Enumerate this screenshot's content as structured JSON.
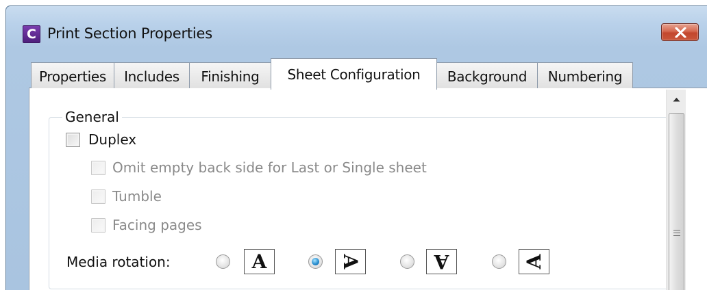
{
  "window": {
    "title": "Print Section Properties",
    "app_icon_letter": "C"
  },
  "tabs": [
    {
      "label": "Properties",
      "active": false
    },
    {
      "label": "Includes",
      "active": false
    },
    {
      "label": "Finishing",
      "active": false
    },
    {
      "label": "Sheet Configuration",
      "active": true
    },
    {
      "label": "Background",
      "active": false
    },
    {
      "label": "Numbering",
      "active": false
    }
  ],
  "general": {
    "group_label": "General",
    "duplex": {
      "label": "Duplex",
      "checked": false,
      "enabled": true
    },
    "omit_empty": {
      "label": "Omit empty back side for Last or Single sheet",
      "checked": false,
      "enabled": false
    },
    "tumble": {
      "label": "Tumble",
      "checked": false,
      "enabled": false
    },
    "facing_pages": {
      "label": "Facing pages",
      "checked": false,
      "enabled": false
    },
    "media_rotation": {
      "label": "Media rotation:",
      "options": [
        {
          "glyph": "A",
          "rotation_deg": 0,
          "selected": false
        },
        {
          "glyph": "A",
          "rotation_deg": 90,
          "selected": true
        },
        {
          "glyph": "A",
          "rotation_deg": 180,
          "selected": false
        },
        {
          "glyph": "A",
          "rotation_deg": 270,
          "selected": false
        }
      ]
    }
  },
  "colors": {
    "accent_radio": "#2a8fd0",
    "close_button": "#c9563a",
    "titlebar": "#b9d1ea"
  }
}
